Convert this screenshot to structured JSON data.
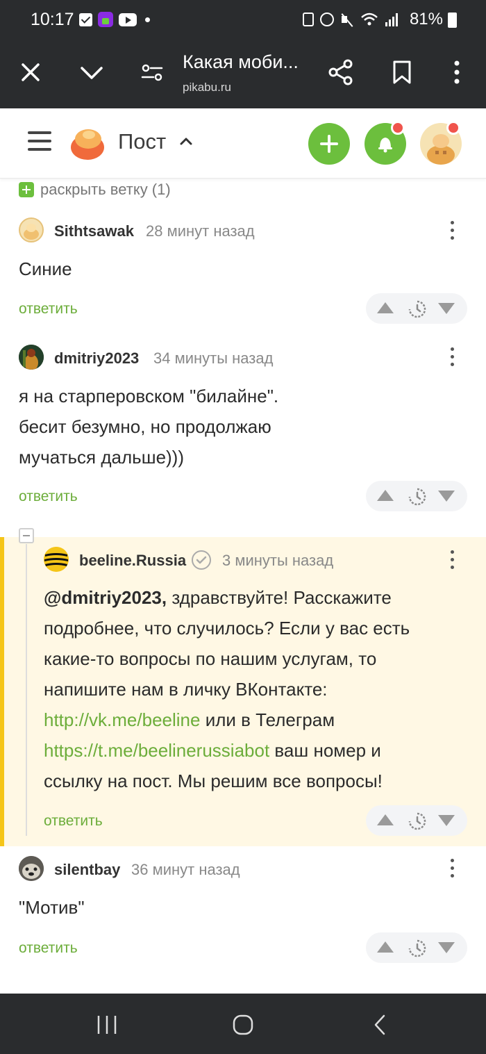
{
  "status_bar": {
    "time": "10:17",
    "battery": "81%"
  },
  "browser": {
    "page_title": "Какая моби...",
    "url": "pikabu.ru"
  },
  "header": {
    "title": "Пост"
  },
  "expand_branch": "раскрыть ветку (1)",
  "reply_label": "ответить",
  "comments": [
    {
      "author": "Sithtsawak",
      "time": "28 минут назад",
      "lines": [
        "Синие"
      ]
    },
    {
      "author": "dmitriy2023",
      "time": "34 минуты назад",
      "lines": [
        "я на старперовском \"билайне\".",
        "бесит безумно, но продолжаю",
        "мучаться дальше)))"
      ]
    },
    {
      "author": "beeline.Russia",
      "time": "3 минуты назад",
      "mention": "@dmitriy2023,",
      "line1_rest": " здравствуйте! Расскажите",
      "line2": "подробнее, что случилось? Если у вас есть",
      "line3": "какие-то вопросы по нашим услугам, то",
      "line4": "напишите нам в личку ВКонтакте:",
      "link1": "http://vk.me/beeline",
      "line5_rest": " или в Телеграм",
      "link2": "https://t.me/beelinerussiabot",
      "line6_rest": " ваш номер и",
      "line7": "ссылку на пост. Мы решим все вопросы!"
    },
    {
      "author": "silentbay",
      "time": "36 минут назад",
      "lines": [
        "\"Мотив\""
      ]
    }
  ],
  "colors": {
    "accent_green": "#6cbf3d",
    "link_green": "#6cad3a",
    "highlight_yellow": "#f5c518",
    "notification_red": "#f0544c"
  }
}
